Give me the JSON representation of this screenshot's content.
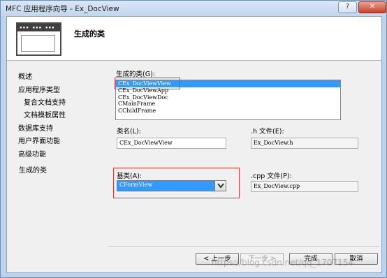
{
  "window": {
    "title": "MFC 应用程序向导 - Ex_DocView",
    "help_label": "?",
    "close_label": "✕"
  },
  "header": {
    "title": "生成的类",
    "illus_dots": "▪▪▪ ▪▪▪ ▪▪▪"
  },
  "nav": {
    "items": [
      {
        "label": "概述"
      },
      {
        "label": "应用程序类型"
      },
      {
        "label": "复合文档支持"
      },
      {
        "label": "文档模板属性"
      },
      {
        "label": "数据库支持"
      },
      {
        "label": "用户界面功能"
      },
      {
        "label": "高级功能"
      },
      {
        "label": "生成的类"
      }
    ]
  },
  "panel": {
    "classes_label": "生成的类(G):",
    "classes": [
      {
        "name": "CEx_DocViewView",
        "selected": true
      },
      {
        "name": "CEx_DocViewApp",
        "selected": false
      },
      {
        "name": "CEx_DocViewDoc",
        "selected": false
      },
      {
        "name": "CMainFrame",
        "selected": false
      },
      {
        "name": "CChildFrame",
        "selected": false
      }
    ],
    "class_name_label": "类名(L):",
    "class_name_value": "CEx_DocViewView",
    "h_file_label": ".h 文件(E):",
    "h_file_value": "Ex_DocView.h",
    "base_class_label": "基类(A):",
    "base_class_value": "CFormView",
    "cpp_file_label": ".cpp 文件(P):",
    "cpp_file_value": "Ex_DocView.cpp"
  },
  "buttons": {
    "prev": "< 上一步",
    "next": "下一步 >",
    "finish": "完成",
    "cancel": "取消"
  },
  "watermark": "https://blog.csdn.net/qq_1707154",
  "colors": {
    "selection": "#3399ff",
    "highlight_box": "#e03a3a",
    "frame": "#bcd2ea"
  }
}
